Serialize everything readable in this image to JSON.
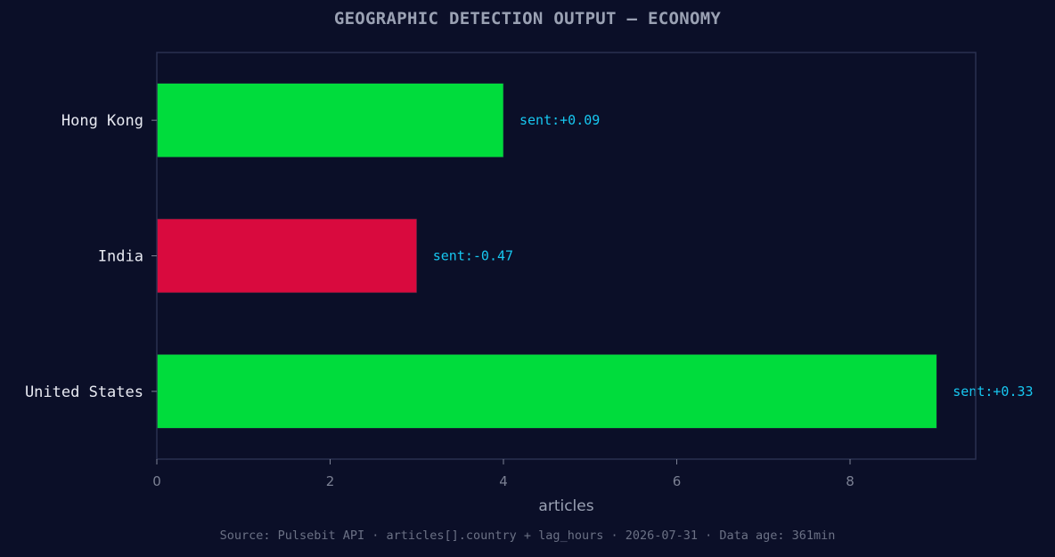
{
  "header": {
    "title": "GEOGRAPHIC DETECTION OUTPUT — ECONOMY"
  },
  "footer": {
    "source": "Source: Pulsebit API · articles[].country + lag_hours · 2026-07-31 · Data age: 361min"
  },
  "colors": {
    "background": "#0b0f28",
    "frame": "#2b3150",
    "positive": "#00dc3c",
    "negative": "#d90a3e",
    "annotation": "#17c7f0",
    "tick_text": "#7b8093",
    "category_text": "#e8eaf2",
    "axis_label": "#9aa1b3"
  },
  "chart_data": {
    "type": "bar",
    "orientation": "horizontal",
    "title": "GEOGRAPHIC DETECTION OUTPUT — ECONOMY",
    "xlabel": "articles",
    "ylabel": "",
    "xlim": [
      0,
      9.45
    ],
    "xticks": [
      0,
      2,
      4,
      6,
      8
    ],
    "grid": false,
    "categories": [
      "Hong Kong",
      "India",
      "United States"
    ],
    "values": [
      4,
      3,
      9
    ],
    "sentiment": [
      0.09,
      -0.47,
      0.33
    ],
    "annotations": [
      "sent:+0.09",
      "sent:-0.47",
      "sent:+0.33"
    ]
  }
}
